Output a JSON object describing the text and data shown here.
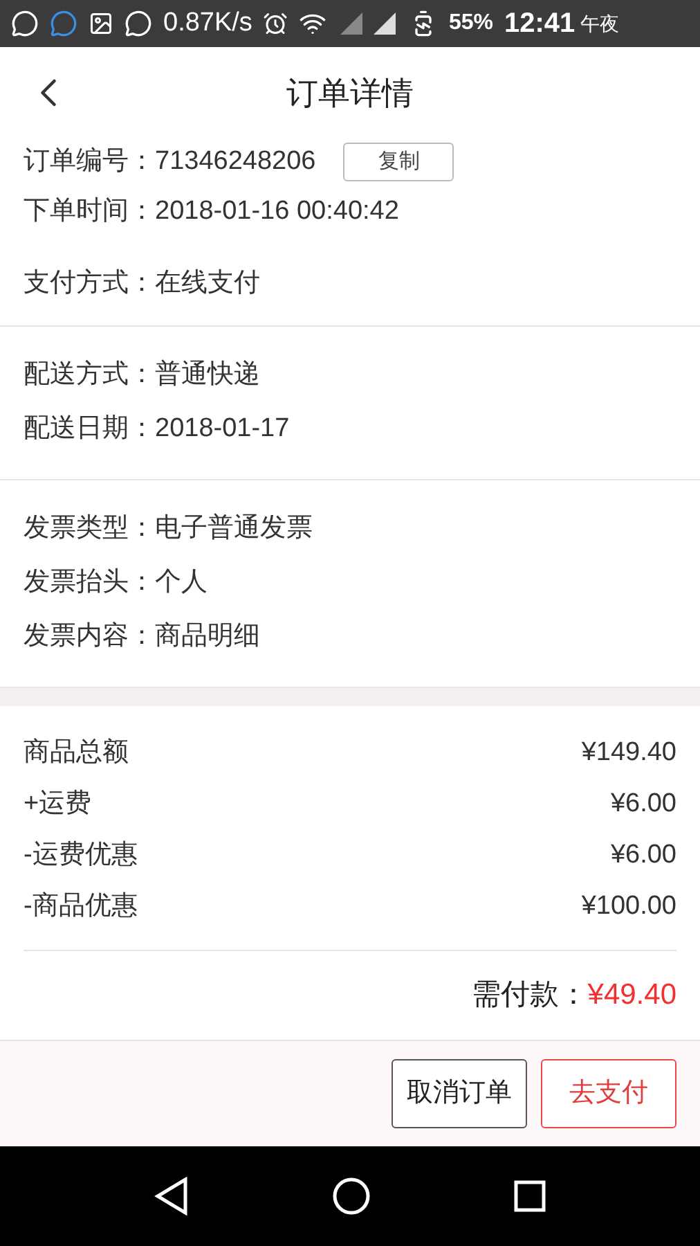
{
  "status_bar": {
    "speed": "0.87K/s",
    "battery": "55%",
    "time": "12:41",
    "period": "午夜"
  },
  "header": {
    "title": "订单详情"
  },
  "order_info": [
    {
      "label": "订单编号：",
      "value": "71346248206",
      "action": "复制"
    },
    {
      "label": "下单时间：",
      "value": "2018-01-16 00:40:42"
    }
  ],
  "payment": {
    "label": "支付方式：",
    "value": "在线支付"
  },
  "delivery": [
    {
      "label": "配送方式：",
      "value": "普通快递"
    },
    {
      "label": "配送日期：",
      "value": "2018-01-17"
    }
  ],
  "invoice": [
    {
      "label": "发票类型：",
      "value": "电子普通发票"
    },
    {
      "label": "发票抬头：",
      "value": "个人"
    },
    {
      "label": "发票内容：",
      "value": "商品明细"
    }
  ],
  "amounts": [
    {
      "label": "商品总额",
      "value": "¥149.40"
    },
    {
      "label": "+运费",
      "value": "¥6.00"
    },
    {
      "label": "-运费优惠",
      "value": "¥6.00"
    },
    {
      "label": "-商品优惠",
      "value": "¥100.00"
    }
  ],
  "total": {
    "label": "需付款：",
    "value": "¥49.40"
  },
  "buttons": [
    {
      "label": "取消订单",
      "kind": "secondary"
    },
    {
      "label": "去支付",
      "kind": "primary"
    }
  ]
}
